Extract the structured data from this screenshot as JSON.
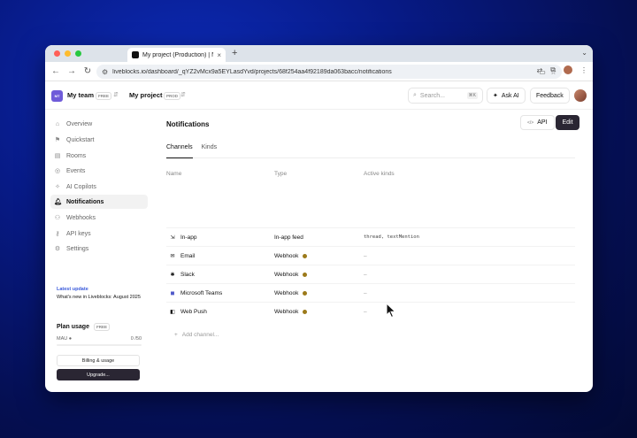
{
  "browser": {
    "tab_title": "My project (Production) | No",
    "url": "liveblocks.io/dashboard/_qYZ2vMcx9a5EYLasdYvd/projects/68f254aa4f92189da063bacc/notifications",
    "dot_colors": [
      "#ff5f57",
      "#febc2e",
      "#28c840"
    ]
  },
  "header": {
    "team_initials": "MT",
    "team_name": "My team",
    "team_plan": "FREE",
    "project_name": "My project",
    "project_env": "PROD",
    "search_placeholder": "Search...",
    "search_shortcut": "⌘K",
    "ask_ai": "Ask AI",
    "feedback": "Feedback"
  },
  "sidebar": {
    "items": [
      {
        "label": "Overview",
        "icon": "home-icon"
      },
      {
        "label": "Quickstart",
        "icon": "flag-icon"
      },
      {
        "label": "Rooms",
        "icon": "rooms-icon"
      },
      {
        "label": "Events",
        "icon": "events-icon"
      },
      {
        "label": "AI Copilots",
        "icon": "sparkle-icon"
      },
      {
        "label": "Notifications",
        "icon": "bell-icon"
      },
      {
        "label": "Webhooks",
        "icon": "webhook-icon"
      },
      {
        "label": "API keys",
        "icon": "key-icon"
      },
      {
        "label": "Settings",
        "icon": "gear-icon"
      }
    ],
    "update_label": "Latest update",
    "update_text": "What's new in Liveblocks: August 2025",
    "usage_title": "Plan usage",
    "usage_plan": "FREE",
    "mau_label": "MAU",
    "mau_value": "0 /50",
    "mau_fraction": 0,
    "billing_label": "Billing & usage",
    "upgrade_label": "Upgrade..."
  },
  "main": {
    "title": "Notifications",
    "api_label": "API",
    "edit_label": "Edit",
    "tabs": [
      "Channels",
      "Kinds"
    ],
    "columns": [
      "Name",
      "Type",
      "Active kinds"
    ],
    "rows": [
      {
        "name": "In-app",
        "type": "In-app feed",
        "kinds": "thread, textMention",
        "icon": "inbox-icon"
      },
      {
        "name": "Email",
        "type": "Webhook",
        "kinds": "–",
        "icon": "mail-icon"
      },
      {
        "name": "Slack",
        "type": "Webhook",
        "kinds": "–",
        "icon": "slack-icon"
      },
      {
        "name": "Microsoft Teams",
        "type": "Webhook",
        "kinds": "–",
        "icon": "teams-icon"
      },
      {
        "name": "Web Push",
        "type": "Webhook",
        "kinds": "–",
        "icon": "push-icon"
      }
    ],
    "add_channel": "Add channel..."
  }
}
